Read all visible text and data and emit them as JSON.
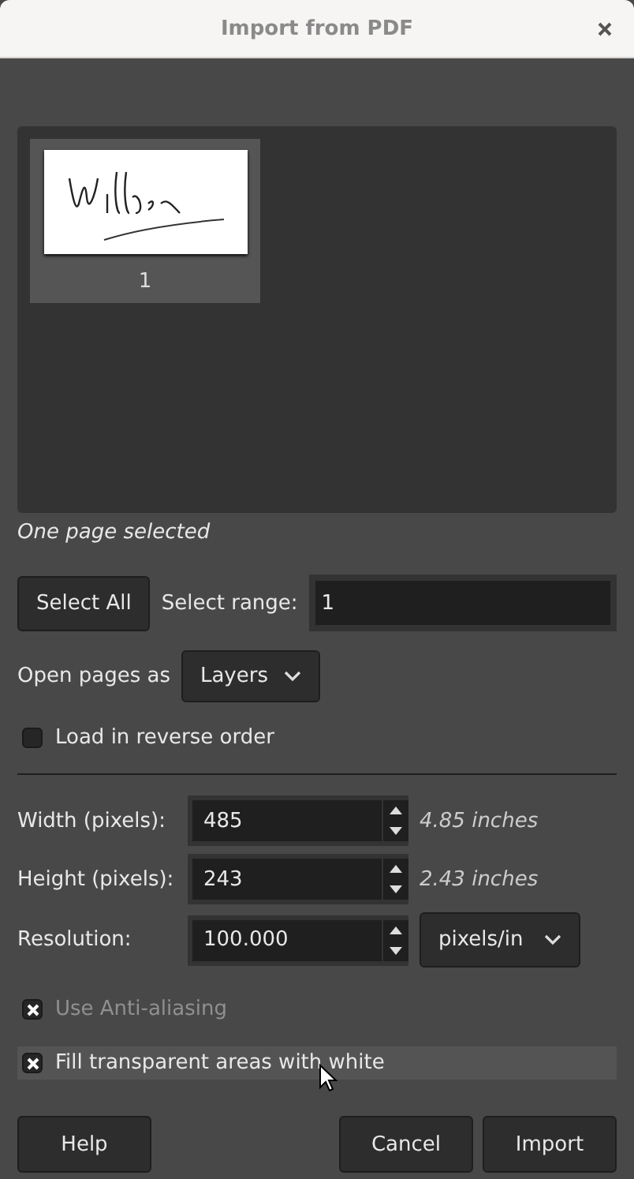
{
  "window": {
    "title": "Import from PDF"
  },
  "pages": [
    {
      "label": "1",
      "selected": true
    }
  ],
  "selection_status": "One page selected",
  "select_all_button": "Select All",
  "select_range": {
    "label": "Select range:",
    "value": "1"
  },
  "open_pages_as": {
    "label": "Open pages as",
    "value": "Layers"
  },
  "reverse_order": {
    "label": "Load in reverse order",
    "checked": false,
    "disabled": false,
    "hovered": false
  },
  "size_fields": [
    {
      "label": "Width (pixels):",
      "value": "485",
      "note": "4.85 inches"
    },
    {
      "label": "Height (pixels):",
      "value": "243",
      "note": "2.43 inches"
    }
  ],
  "resolution": {
    "label": "Resolution:",
    "value": "100.000",
    "unit": "pixels/in"
  },
  "options": [
    {
      "label": "Use Anti-aliasing",
      "checked": true,
      "disabled": true,
      "hovered": false
    },
    {
      "label": "Fill transparent areas with white",
      "checked": true,
      "disabled": false,
      "hovered": true
    }
  ],
  "buttons": {
    "help": "Help",
    "cancel": "Cancel",
    "import": "Import"
  }
}
